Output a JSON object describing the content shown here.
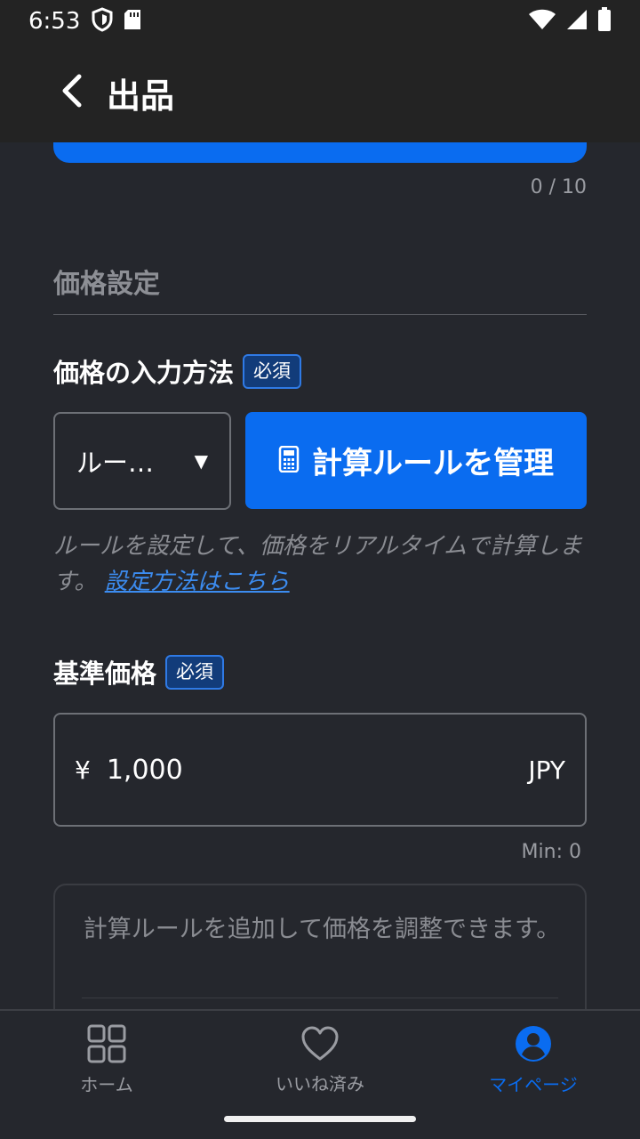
{
  "status_bar": {
    "time": "6:53"
  },
  "app_bar": {
    "title": "出品"
  },
  "image_counter": "0 / 10",
  "price_section": {
    "title": "価格設定",
    "input_method": {
      "label": "価格の入力方法",
      "required": "必須",
      "selected": "ルー…",
      "manage_button": "計算ルールを管理",
      "helper_text": "ルールを設定して、価格をリアルタイムで計算します。",
      "helper_link": "設定方法はこちら"
    },
    "base_price": {
      "label": "基準価格",
      "required": "必須",
      "currency_symbol": "¥",
      "value": "1,000",
      "currency_code": "JPY",
      "min_text": "Min: 0"
    },
    "rule_card_text": "計算ルールを追加して価格を調整できます。"
  },
  "bottom_nav": {
    "items": [
      {
        "label": "ホーム",
        "icon": "grid-icon",
        "active": false
      },
      {
        "label": "いいね済み",
        "icon": "heart-icon",
        "active": false
      },
      {
        "label": "マイページ",
        "icon": "account-circle-icon",
        "active": true
      }
    ]
  },
  "colors": {
    "accent": "#0a6cf0",
    "background": "#25272d",
    "appbar": "#232323",
    "muted": "#8a8c92"
  }
}
